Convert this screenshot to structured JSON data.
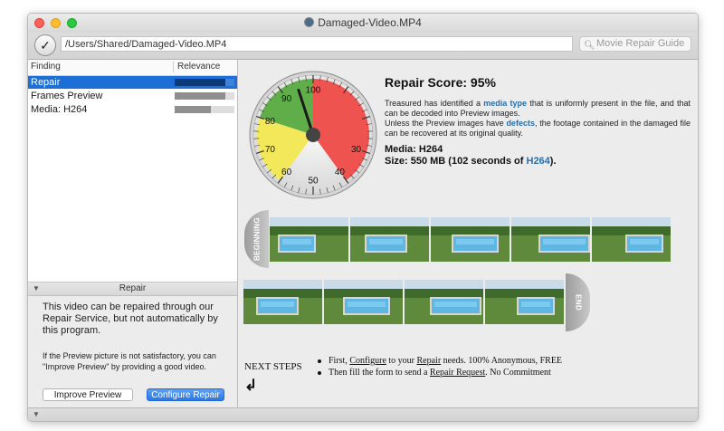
{
  "window": {
    "title": "Damaged-Video.MP4"
  },
  "toolbar": {
    "path_value": "/Users/Shared/Damaged-Video.MP4",
    "search_placeholder": "Movie Repair Guide"
  },
  "findings": {
    "columns": [
      "Finding",
      "Relevance"
    ],
    "rows": [
      {
        "label": "Repair",
        "relevance": 0.85,
        "selected": true
      },
      {
        "label": "Frames Preview",
        "relevance": 0.85,
        "selected": false
      },
      {
        "label": "Media: H264",
        "relevance": 0.6,
        "selected": false
      }
    ]
  },
  "info_panel": {
    "title": "Repair",
    "text": "This video can be repaired through our Repair Service, but not automatically by this program.",
    "hint": "If the Preview picture is not satisfactory, you can \"Improve Preview\" by providing a good video.",
    "improve_label": "Improve Preview",
    "configure_label": "Configure Repair"
  },
  "gauge": {
    "value": 95,
    "ticks": [
      "100",
      "90",
      "80",
      "70",
      "60",
      "50",
      "40",
      "30"
    ],
    "colors": {
      "green": "#5fae4a",
      "yellow": "#f3e85a",
      "red": "#ef5350"
    }
  },
  "report": {
    "score_label": "Repair Score: 95%",
    "desc_1a": "Treasured has identified a ",
    "desc_1_link": "media type",
    "desc_1b": " that is uniformly present in the file, and that can be decoded into Preview images.",
    "desc_2a": "Unless the Preview images have ",
    "desc_2_link": "defects",
    "desc_2b": ", the footage contained in the damaged file can be recovered at its original quality.",
    "media_line": "Media: H264",
    "size_prefix": "Size: 550 MB (102 seconds of ",
    "size_link": "H264",
    "size_suffix": ")."
  },
  "preview": {
    "begin_label": "BEGINNING",
    "end_label": "END",
    "frame_count_row1": 5,
    "frame_count_row2": 4
  },
  "next_steps": {
    "label": "NEXT STEPS",
    "arrow": "↲",
    "step1_a": "First, ",
    "step1_link1": "Configure",
    "step1_b": " to your ",
    "step1_link2": "Repair",
    "step1_c": " needs. 100% Anonymous, FREE",
    "step2_a": "Then fill the form to send a ",
    "step2_link": "Repair Request",
    "step2_b": ". No Commitment"
  }
}
